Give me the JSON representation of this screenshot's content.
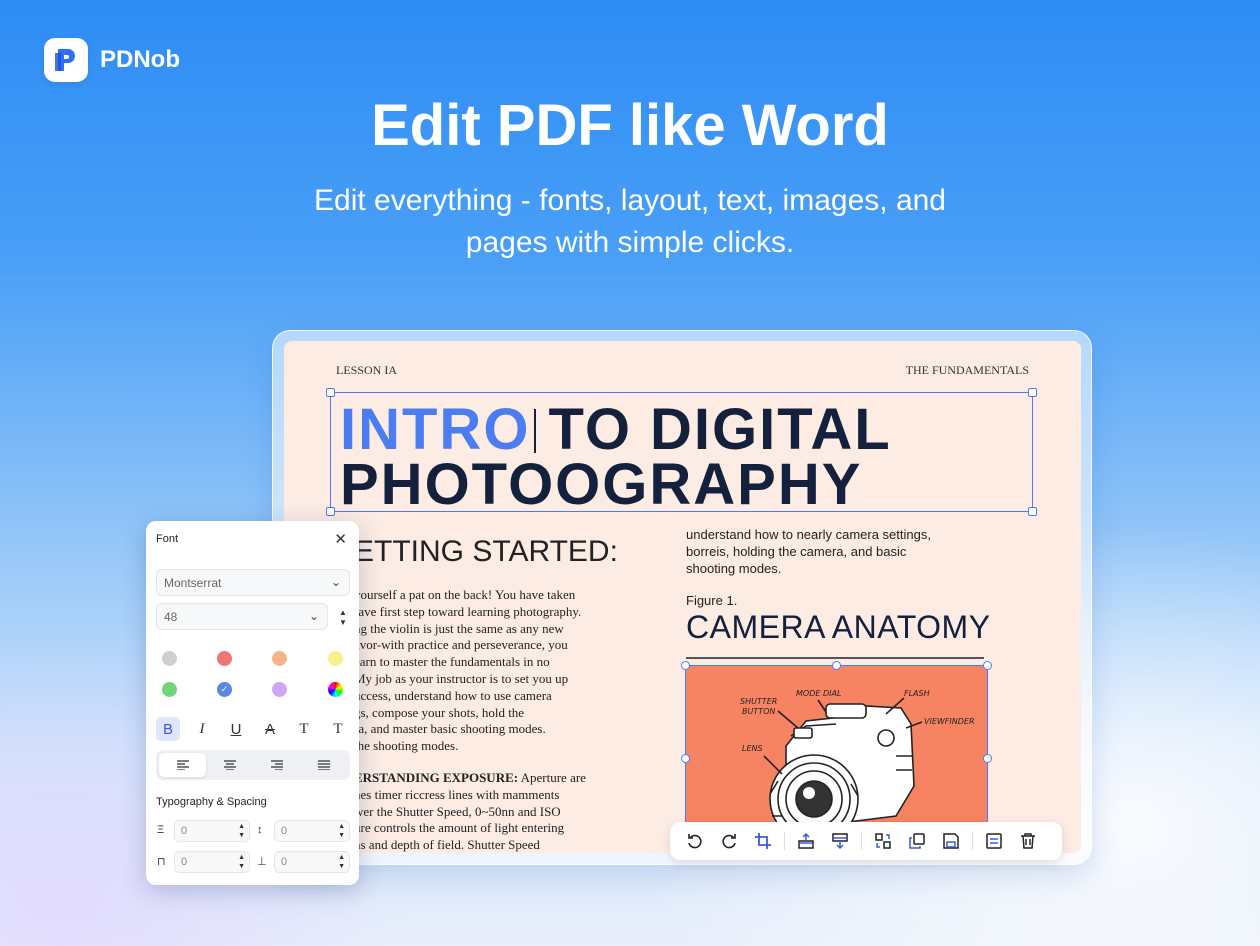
{
  "brand": {
    "name": "PDNob",
    "logo_letter": "P"
  },
  "hero": {
    "headline": "Edit PDF like Word",
    "sub_line1": "Edit everything - fonts, layout, text, images, and",
    "sub_line2": "pages with simple clicks."
  },
  "document": {
    "header_left": "LESSON IA",
    "header_right": "THE FUNDAMENTALS",
    "title_part1": "INTRO",
    "title_part2": "TO DIGITAL",
    "title_line2": "PHOTOOGRAPHY",
    "section_heading": "ETTING STARTED:",
    "left_paragraph": [
      "yourself a pat on the back! You have taken",
      "rave first step toward learning photography.",
      "ng the violin is just the same as any new",
      "avor-with practice and perseverance, you",
      "earn to master the fundamentals in no",
      "My job as your instructor is to set you up",
      "uccess, understand how to use camera",
      "gs, compose your shots, hold the",
      "ra, and master basic shooting modes.",
      "the shooting modes."
    ],
    "exposure_heading": "ERSTANDING EXPOSURE:",
    "exposure_lines": [
      " Aperture are",
      "nes timer riccress lines with mamments",
      "wer the Shutter Speed, 0~50nn and ISO",
      "ure controls the amount of light entering",
      "ns and depth of field. Shutter Speed"
    ],
    "right_lines": [
      "understand how to nearly camera settings,",
      "borreis, holding the camera, and basic",
      "shooting modes."
    ],
    "figure_label": "Figure 1.",
    "figure_title": "CAMERA ANATOMY",
    "image_labels": {
      "shutter": "SHUTTER",
      "button": "BUTTON",
      "mode_dial": "MODE DIAL",
      "flash": "FLASH",
      "viewfinder": "VIEWFINDER",
      "lens": "LENS"
    },
    "image_bg": "#f68462"
  },
  "font_panel": {
    "title": "Font",
    "font_family": "Montserrat",
    "font_size": "48",
    "colors": [
      "#cfcfcf",
      "#f07676",
      "#f7b38a",
      "#f8ef8e",
      "#6fd47a",
      "#5b86e8",
      "#cda6f5",
      "rainbow"
    ],
    "selected_color": "#5b86e8",
    "format_buttons": [
      "B",
      "I",
      "U",
      "A",
      "T",
      "T"
    ],
    "section_title": "Typography & Spacing",
    "spacing_values": [
      "0",
      "0",
      "0",
      "0"
    ]
  },
  "colors": {
    "accent": "#4c7cf2",
    "title_dark": "#14213d",
    "page_bg": "#fcece4"
  }
}
